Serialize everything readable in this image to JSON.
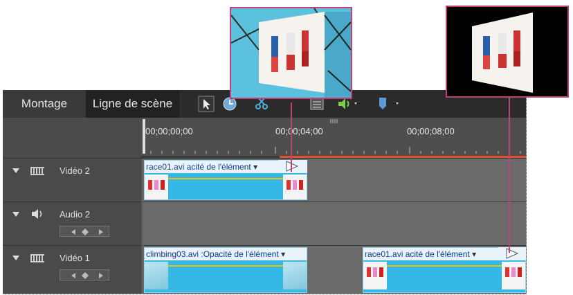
{
  "tabs": {
    "montage": "Montage",
    "timeline": "Ligne de scène"
  },
  "timecodes": [
    "00;00;00;00",
    "00;00;04;00",
    "00;00;08;00"
  ],
  "tracks": [
    {
      "label": "Vidéo 2"
    },
    {
      "label": "Audio 2"
    },
    {
      "label": "Vidéo 1"
    }
  ],
  "clips": {
    "v2_race": {
      "name": "race01.avi",
      "property": "acité de l'élément"
    },
    "v1_climb": {
      "name": "climbing03.avi",
      "property": ":Opacité de l'élément"
    },
    "v1_race": {
      "name": "race01.avi",
      "property": "acité de l'élément"
    }
  },
  "colors": {
    "clip": "#35b8e6",
    "callout": "#c0407a",
    "playhead_bar": "#e0502a"
  }
}
